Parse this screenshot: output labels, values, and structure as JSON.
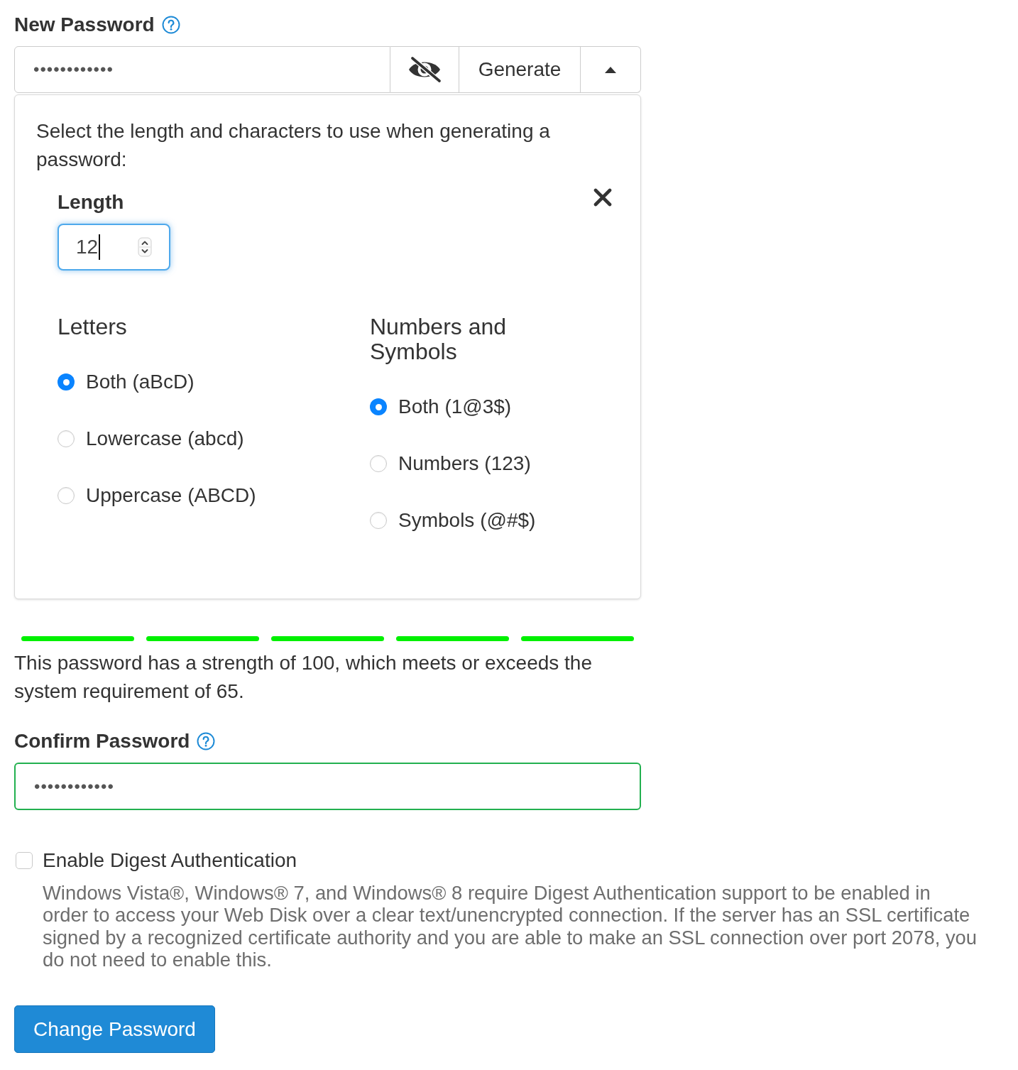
{
  "new_password": {
    "label": "New Password",
    "value": "••••••••••••",
    "generate_button": "Generate"
  },
  "generator": {
    "expanded": true,
    "instructions": "Select the length and characters to use when generating a password:",
    "length": {
      "label": "Length",
      "value": "12"
    },
    "groups": [
      {
        "title": "Letters",
        "options": [
          {
            "label": "Both (aBcD)",
            "selected": true
          },
          {
            "label": "Lowercase (abcd)",
            "selected": false
          },
          {
            "label": "Uppercase (ABCD)",
            "selected": false
          }
        ]
      },
      {
        "title": "Numbers and Symbols",
        "options": [
          {
            "label": "Both (1@3$)",
            "selected": true
          },
          {
            "label": "Numbers (123)",
            "selected": false
          },
          {
            "label": "Symbols (@#$)",
            "selected": false
          }
        ]
      }
    ]
  },
  "strength_meter": {
    "segments": [
      {
        "filled": true
      },
      {
        "filled": true
      },
      {
        "filled": true
      },
      {
        "filled": true
      },
      {
        "filled": true
      }
    ],
    "message": "This password has a strength of 100, which meets or exceeds the system requirement of 65."
  },
  "confirm_password": {
    "label": "Confirm Password",
    "value": "••••••••••••",
    "valid": true
  },
  "digest_authentication": {
    "label": "Enable Digest Authentication",
    "checked": false,
    "description": "Windows Vista®, Windows® 7, and Windows® 8 require Digest Authentication support to be enabled in order to access your Web Disk over a clear text/unencrypted connection. If the server has an SSL certificate signed by a recognized certificate authority and you are able to make an SSL connection over port 2078, you do not need to enable this."
  },
  "submit_button": "Change Password"
}
